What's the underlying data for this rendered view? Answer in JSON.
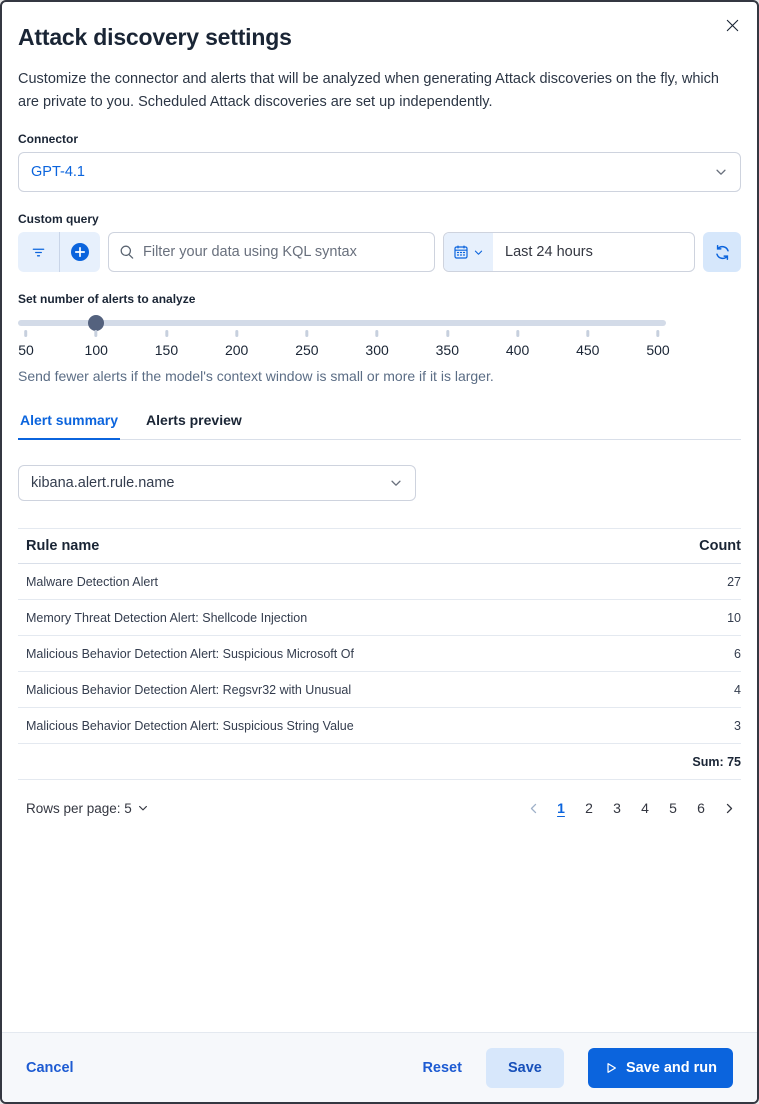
{
  "dialog": {
    "title": "Attack discovery settings",
    "description": "Customize the connector and alerts that will be analyzed when generating Attack discoveries on the fly, which are private to you. Scheduled Attack discoveries are set up independently."
  },
  "connector": {
    "label": "Connector",
    "value": "GPT-4.1"
  },
  "query": {
    "label": "Custom query",
    "search_placeholder": "Filter your data using KQL syntax",
    "time_range": "Last 24 hours"
  },
  "slider": {
    "label": "Set number of alerts to analyze",
    "value": 100,
    "min": 50,
    "max": 500,
    "ticks": [
      "50",
      "100",
      "150",
      "200",
      "250",
      "300",
      "350",
      "400",
      "450",
      "500"
    ],
    "help": "Send fewer alerts if the model's context window is small or more if it is larger."
  },
  "tabs": [
    {
      "label": "Alert summary",
      "active": true
    },
    {
      "label": "Alerts preview",
      "active": false
    }
  ],
  "field_select": {
    "value": "kibana.alert.rule.name"
  },
  "table": {
    "columns": {
      "name": "Rule name",
      "count": "Count"
    },
    "rows": [
      {
        "name": "Malware Detection Alert",
        "count": "27"
      },
      {
        "name": "Memory Threat Detection Alert: Shellcode Injection",
        "count": "10"
      },
      {
        "name": "Malicious Behavior Detection Alert: Suspicious Microsoft Of",
        "count": "6"
      },
      {
        "name": "Malicious Behavior Detection Alert: Regsvr32 with Unusual",
        "count": "4"
      },
      {
        "name": "Malicious Behavior Detection Alert: Suspicious String Value",
        "count": "3"
      }
    ],
    "sum": "Sum: 75"
  },
  "pagination": {
    "rows_per_page": "Rows per page: 5",
    "pages": [
      "1",
      "2",
      "3",
      "4",
      "5",
      "6"
    ],
    "active_page": "1"
  },
  "footer": {
    "cancel": "Cancel",
    "reset": "Reset",
    "save": "Save",
    "save_and_run": "Save and run"
  },
  "colors": {
    "primary": "#0b64dd",
    "accent_bg": "#e7f0fc",
    "title_text": "#1a2535",
    "subdued_text": "#5b6d85",
    "border": "#ced3de",
    "footer_bg": "#f6f8fb",
    "slider_thumb": "#54627e"
  }
}
